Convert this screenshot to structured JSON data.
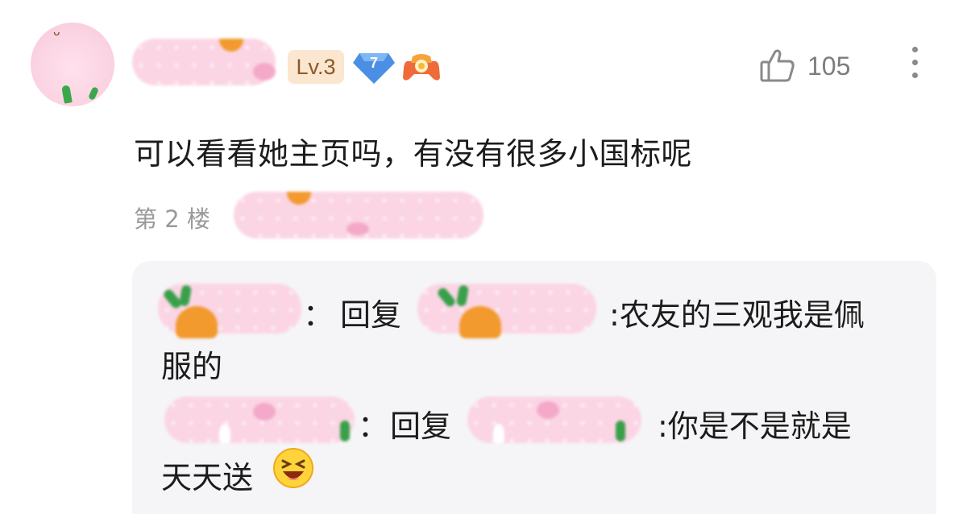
{
  "comment": {
    "level_badge": "Lv.3",
    "diamond_level": "7",
    "like_count": "105",
    "text": "可以看看她主页吗，有没有很多小国标呢",
    "floor": "第 2 楼",
    "icons": [
      "avatar",
      "diamond-badge-icon",
      "game-controller-icon",
      "thumbs-up-icon",
      "more-vertical-icon"
    ]
  },
  "replies": [
    {
      "separator": "：",
      "reply_word": "回复",
      "content_line1": ":农友的三观我是佩",
      "content_line2": "服的"
    },
    {
      "separator": "：",
      "reply_word": "回复",
      "content_line1": ":你是不是就是",
      "content_line2": "天天送",
      "emoji": "laughing-emoji-icon"
    }
  ],
  "colors": {
    "text": "#1c1c1c",
    "muted": "#9a9a9a",
    "reply_bg": "#f5f5f7",
    "level_badge_bg": "#fbe6cf",
    "diamond": "#4a90e2"
  }
}
